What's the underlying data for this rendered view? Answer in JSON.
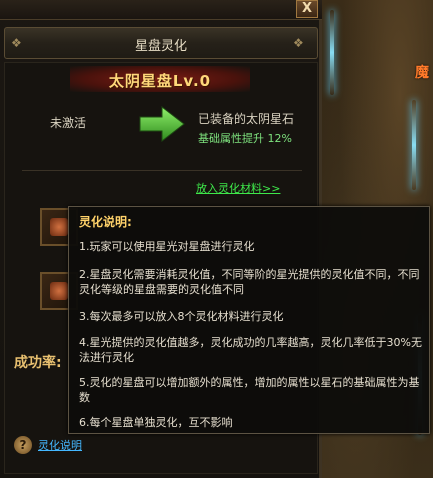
{
  "window": {
    "close_label": "X",
    "title": "星盘灵化"
  },
  "star": {
    "name": "太阴星盘Lv.0",
    "status": "未激活",
    "equipped": "已装备的太阴星石",
    "bonus": "基础属性提升 12%"
  },
  "materials_link": "放入灵化材料>>",
  "rate_label": "成功率:",
  "help": {
    "icon_glyph": "?",
    "label": "灵化说明"
  },
  "tooltip": {
    "title": "灵化说明:",
    "items": [
      "1.玩家可以使用星光对星盘进行灵化",
      "2.星盘灵化需要消耗灵化值，不同等阶的星光提供的灵化值不同，不同灵化等级的星盘需要的灵化值不同",
      "3.每次最多可以放入8个灵化材料进行灵化",
      "4.星光提供的灵化值越多，灵化成功的几率越高，灵化几率低于30%无法进行灵化",
      "5.灵化的星盘可以增加额外的属性，增加的属性以星石的基础属性为基数",
      "6.每个星盘单独灵化，互不影响"
    ]
  },
  "scene": {
    "npc_glyph": "魔"
  },
  "colors": {
    "accent_gold": "#ffd77a",
    "link_green": "#3ee84a",
    "link_blue": "#44b8ff",
    "bonus_green": "#7ee27e"
  }
}
